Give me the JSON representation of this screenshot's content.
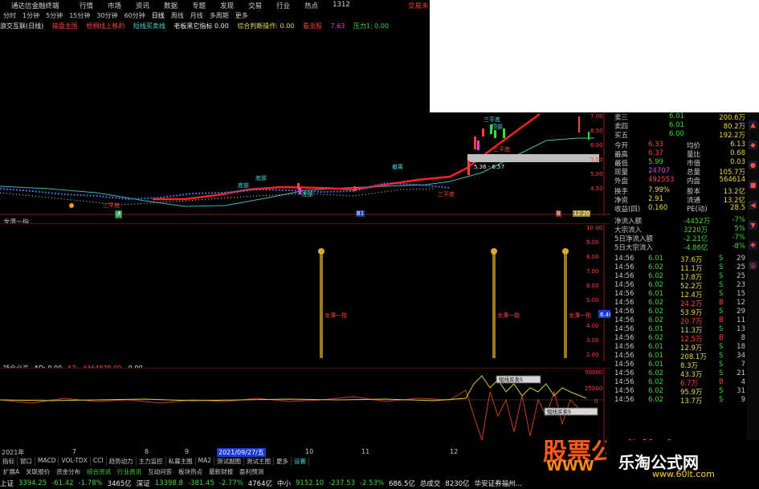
{
  "titlebar": {
    "app": "通达信金融终端",
    "menu": [
      "行情",
      "市场",
      "资讯",
      "数据",
      "专题",
      "发现",
      "交易",
      "行业",
      "热点",
      "1312"
    ],
    "trade": "交易未"
  },
  "periodbar": [
    "分时",
    "1分钟",
    "5分钟",
    "15分钟",
    "30分钟",
    "60分钟",
    "日线",
    "周线",
    "月线",
    "多周期",
    "更多"
  ],
  "indbar": {
    "name": "浪交互联(日线)",
    "items": [
      "操盘主图",
      "梧桐线上移的",
      "短线买卖线",
      "老板黑它指标 0.00",
      "综合判断操作: 0.00",
      "看涨股",
      "7.63",
      "压力1: 0.00"
    ]
  },
  "price_labels": [
    "三平底",
    "三平底",
    "三平底",
    "三平底",
    "顶部",
    "底部",
    "撤离",
    "底部",
    "底部"
  ],
  "price_box": "5.36 - 6.57",
  "price_axis": [
    "7.00",
    "6.50",
    "6.00",
    "5.50",
    "5.00",
    "4.50"
  ],
  "markers": [
    "诱",
    "B1",
    "B",
    "12:20"
  ],
  "panel2": {
    "title": "龙潭一指",
    "axis": [
      "10.00",
      "9.00",
      "8.00",
      "7.00",
      "6.00",
      "5.00",
      "4.00",
      "3.00",
      "2.00"
    ],
    "current": "6.48",
    "signal_label": "龙潭一指"
  },
  "panel3": {
    "title": "钱会必杀",
    "ad": "AD: 0.00",
    "az": "AZ: -4464878.00",
    "z": "0.00",
    "axis": [
      "50000",
      "25000",
      "0"
    ],
    "tag": "短线买卖5"
  },
  "xdates": [
    "2021年",
    "7",
    "8",
    "9",
    "2021/09/27/五",
    "10",
    "11",
    "12"
  ],
  "tabs": [
    "指标",
    "窗口",
    "MACD",
    "VOL-TDX",
    "CCI",
    "趋势动力",
    "主力监控",
    "私募主图",
    "MA2",
    "测试副图",
    "测试主图",
    "更多",
    "设置"
  ],
  "tabs2": [
    "扩展A",
    "关联报价",
    "资金分布",
    "综合资讯",
    "行业资讯",
    "互动问答",
    "板块热点",
    "最新财报",
    "盈利预测"
  ],
  "statusbar": [
    {
      "t": "上证",
      "c": "wh"
    },
    {
      "t": "3394.25",
      "c": "dn"
    },
    {
      "t": "-61.42",
      "c": "dn"
    },
    {
      "t": "-1.78%",
      "c": "dn"
    },
    {
      "t": "3465亿",
      "c": "wh"
    },
    {
      "t": "深证",
      "c": "wh"
    },
    {
      "t": "13398.8",
      "c": "dn"
    },
    {
      "t": "-381.45",
      "c": "dn"
    },
    {
      "t": "-2.77%",
      "c": "dn"
    },
    {
      "t": "4764亿",
      "c": "wh"
    },
    {
      "t": "中小",
      "c": "wh"
    },
    {
      "t": "9152.10",
      "c": "dn"
    },
    {
      "t": "-237.53",
      "c": "dn"
    },
    {
      "t": "-2.53%",
      "c": "dn"
    },
    {
      "t": "686.5亿",
      "c": "wh"
    },
    {
      "t": "总成交",
      "c": "wh"
    },
    {
      "t": "8230亿",
      "c": "wh"
    },
    {
      "t": "华安证券福州…",
      "c": "wh"
    }
  ],
  "quote": {
    "asks": [
      {
        "l": "卖三",
        "p": "6.01",
        "v": "200.6万"
      },
      {
        "l": "卖四",
        "p": "6.01",
        "v": "80.2万"
      },
      {
        "l": "买五",
        "p": "6.00",
        "v": "192.2万"
      }
    ],
    "stats": [
      {
        "l1": "今开",
        "v1": "6.33",
        "l2": "均价",
        "v2": "6.13"
      },
      {
        "l1": "最高",
        "v1": "6.37",
        "l2": "量比",
        "v2": "0.68"
      },
      {
        "l1": "最低",
        "v1": "5.99",
        "l2": "市值",
        "v2": "0.03"
      },
      {
        "l1": "现量",
        "v1": "24707",
        "l2": "总量",
        "v2": "105.7万"
      },
      {
        "l1": "外盘",
        "v1": "492553",
        "l2": "内盘",
        "v2": "564614"
      }
    ],
    "fund": [
      {
        "l1": "换手",
        "v1": "7.99%",
        "l2": "股本",
        "v2": "13.2亿"
      },
      {
        "l1": "净资",
        "v1": "2.91",
        "l2": "流通",
        "v2": "13.2亿"
      },
      {
        "l1": "收益(四)",
        "v1": "0.160",
        "l2": "PE(动)",
        "v2": "28.5"
      }
    ],
    "flow": [
      {
        "l": "净流入额",
        "v": "-4452万",
        "p": "-7%"
      },
      {
        "l": "大宗流入",
        "v": "3220万",
        "p": "5%"
      },
      {
        "l": "5日净流入额",
        "v": "-2.21亿",
        "p": "-7%"
      },
      {
        "l": "5日大宗流入",
        "v": "-4.86亿",
        "p": "-8%"
      }
    ],
    "ticks": [
      {
        "t": "14:56",
        "p": "6.01",
        "v": "37.6万",
        "s": "S",
        "n": "29"
      },
      {
        "t": "14:56",
        "p": "6.02",
        "v": "11.1万",
        "s": "S",
        "n": "25"
      },
      {
        "t": "14:56",
        "p": "6.02",
        "v": "17.8万",
        "s": "S",
        "n": "25"
      },
      {
        "t": "14:56",
        "p": "6.02",
        "v": "52.2万",
        "s": "S",
        "n": "23"
      },
      {
        "t": "14:56",
        "p": "6.01",
        "v": "12.4万",
        "s": "S",
        "n": "15"
      },
      {
        "t": "14:56",
        "p": "6.02",
        "v": "24.2万",
        "s": "B",
        "n": "12"
      },
      {
        "t": "14:56",
        "p": "6.02",
        "v": "53.9万",
        "s": "S",
        "n": "29"
      },
      {
        "t": "14:56",
        "p": "6.02",
        "v": "20.7万",
        "s": "B",
        "n": "11"
      },
      {
        "t": "14:56",
        "p": "6.01",
        "v": "11.3万",
        "s": "S",
        "n": "13"
      },
      {
        "t": "14:56",
        "p": "6.02",
        "v": "12.5万",
        "s": "B",
        "n": "8"
      },
      {
        "t": "14:56",
        "p": "6.01",
        "v": "12.9万",
        "s": "S",
        "n": "18"
      },
      {
        "t": "14:56",
        "p": "6.01",
        "v": "208.1万",
        "s": "S",
        "n": "34"
      },
      {
        "t": "14:56",
        "p": "6.01",
        "v": "8.3万",
        "s": "S",
        "n": "7"
      },
      {
        "t": "14:56",
        "p": "6.02",
        "v": "43.3万",
        "s": "S",
        "n": "21"
      },
      {
        "t": "14:56",
        "p": "6.02",
        "v": "6.7万",
        "s": "B",
        "n": "4"
      },
      {
        "t": "14:56",
        "p": "6.02",
        "v": "95.9万",
        "s": "S",
        "n": "31"
      },
      {
        "t": "14:56",
        "p": "6.02",
        "v": "13.7万",
        "s": "S",
        "n": "9"
      }
    ]
  },
  "watermark": {
    "big": "股票公式指标网",
    "url_left": "WWW",
    "site": "乐淘公式网",
    "site_url": "www.60lt.com"
  },
  "colors": {
    "up": "#ff4040",
    "down": "#3cd83c",
    "yellow": "#e8d84a",
    "cyan": "#4ad8d8",
    "ma_red": "#ff2020",
    "gold": "#c8a030"
  }
}
